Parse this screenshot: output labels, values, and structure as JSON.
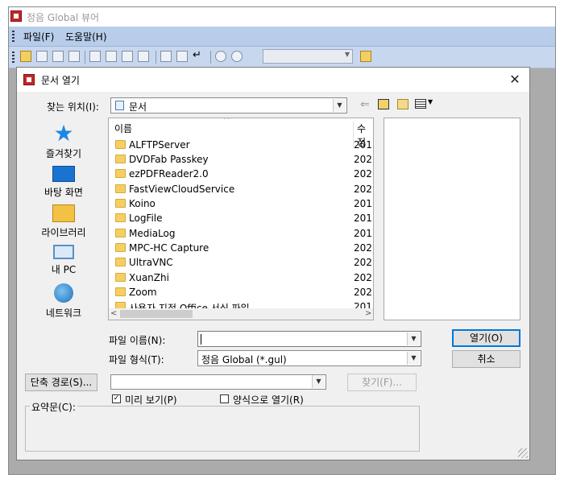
{
  "app": {
    "title": "정음 Global 뷰어",
    "menu": [
      "파일(F)",
      "도움말(H)"
    ]
  },
  "dialog": {
    "title": "문서 열기",
    "look_in_label": "찾는 위치(I):",
    "look_in_value": "문서",
    "places": [
      {
        "label": "즐겨찾기",
        "icon": "star-icon"
      },
      {
        "label": "바탕 화면",
        "icon": "desktop-icon"
      },
      {
        "label": "라이브러리",
        "icon": "library-icon"
      },
      {
        "label": "내 PC",
        "icon": "computer-icon"
      },
      {
        "label": "네트워크",
        "icon": "network-icon"
      }
    ],
    "columns": {
      "name": "이름",
      "modified": "수정"
    },
    "files": [
      {
        "name": "ALFTPServer",
        "date": "201"
      },
      {
        "name": "DVDFab Passkey",
        "date": "202"
      },
      {
        "name": "ezPDFReader2.0",
        "date": "202"
      },
      {
        "name": "FastViewCloudService",
        "date": "202"
      },
      {
        "name": "Koino",
        "date": "201"
      },
      {
        "name": "LogFile",
        "date": "201"
      },
      {
        "name": "MediaLog",
        "date": "201"
      },
      {
        "name": "MPC-HC Capture",
        "date": "202"
      },
      {
        "name": "UltraVNC",
        "date": "202"
      },
      {
        "name": "XuanZhi",
        "date": "202"
      },
      {
        "name": "Zoom",
        "date": "202"
      },
      {
        "name": "사용자 지정 Office 서식 파일",
        "date": "201"
      }
    ],
    "filename_label": "파일 이름(N):",
    "filename_value": "",
    "filetype_label": "파일 형식(T):",
    "filetype_value": "정음 Global (*.gul)",
    "open_button": "열기(O)",
    "cancel_button": "취소",
    "shortcut_button": "단축 경로(S)...",
    "find_button": "찾기(F)...",
    "preview_checkbox": {
      "label": "미리 보기(P)",
      "checked": true
    },
    "template_checkbox": {
      "label": "양식으로 열기(R)",
      "checked": false
    },
    "summary_label": "요약문(C):"
  }
}
